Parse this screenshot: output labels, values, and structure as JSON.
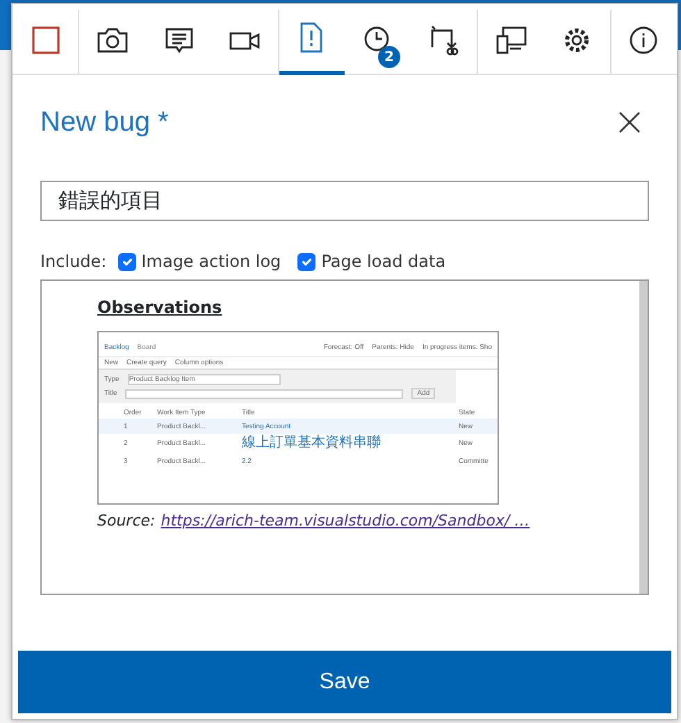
{
  "toolbar": [
    {
      "selected": false
    },
    {
      "selected": false
    },
    {
      "selected": false
    },
    {
      "selected": false
    },
    {
      "selected": true
    },
    {
      "selected": false,
      "badge": "2"
    },
    {
      "selected": false
    },
    {
      "selected": false
    },
    {
      "selected": false
    },
    {
      "selected": false
    }
  ],
  "title": "New bug *",
  "title_field": {
    "value": "錯誤的項目"
  },
  "include": {
    "label": "Include:",
    "options": [
      {
        "label": "Image action log",
        "checked": true
      },
      {
        "label": "Page load data",
        "checked": true
      }
    ]
  },
  "editor": {
    "heading": "Observations",
    "screenshot": {
      "tabs": [
        {
          "label": "Backlog",
          "selected": true
        },
        {
          "label": "Board",
          "selected": false
        }
      ],
      "options": [
        "Forecast: Off",
        "Parents: Hide",
        "In progress items: Sho"
      ],
      "actions": [
        "New",
        "Create query",
        "Column options"
      ],
      "form": {
        "type_label": "Type",
        "type_value": "Product Backlog Item",
        "title_label": "Title",
        "add": "Add"
      },
      "columns": [
        "Order",
        "Work Item Type",
        "Title",
        "State"
      ],
      "rows": [
        {
          "order": "1",
          "type": "Product Backl...",
          "title": "Testing Account",
          "state": "New",
          "selected": true
        },
        {
          "order": "2",
          "type": "Product Backl...",
          "title": "線上訂單基本資料串聯",
          "state": "New",
          "selected": false
        },
        {
          "order": "3",
          "type": "Product Backl...",
          "title": "2.2",
          "state": "Committe",
          "selected": false
        }
      ]
    },
    "source_label": "Source:",
    "source_link": "https://arich-team.visualstudio.com/Sandbox/ …"
  },
  "save": "Save"
}
